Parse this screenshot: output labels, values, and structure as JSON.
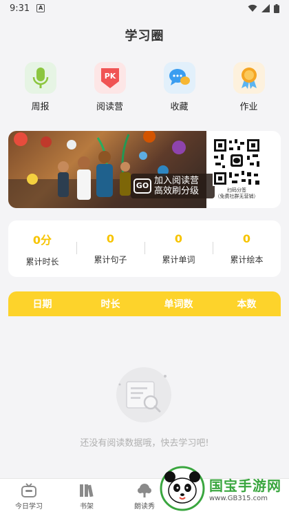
{
  "status": {
    "time": "9:31",
    "notif_letter": "A"
  },
  "title": "学习圈",
  "shortcuts": [
    {
      "label": "周报",
      "icon": "microphone-icon",
      "bg": "#e6f4e4"
    },
    {
      "label": "阅读营",
      "icon": "pk-shield-icon",
      "bg": "#fde6e6",
      "badge": "PK"
    },
    {
      "label": "收藏",
      "icon": "chat-bubble-icon",
      "bg": "#e2f0fb"
    },
    {
      "label": "作业",
      "icon": "medal-icon",
      "bg": "#fdf1dd"
    }
  ],
  "banner": {
    "go": "GO",
    "line1": "加入阅读营",
    "line2": "高效刷分级",
    "qr_line1": "扫码分签",
    "qr_line2": "（免费社群无营销）"
  },
  "stats": [
    {
      "value": "0分",
      "label": "累计时长"
    },
    {
      "value": "0",
      "label": "累计句子"
    },
    {
      "value": "0",
      "label": "累计单词"
    },
    {
      "value": "0",
      "label": "累计绘本"
    }
  ],
  "table_columns": [
    "日期",
    "时长",
    "单词数",
    "本数"
  ],
  "empty_message": "还没有阅读数据哦，快去学习吧!",
  "tabs": [
    {
      "label": "今日学习",
      "icon": "tv-icon"
    },
    {
      "label": "书架",
      "icon": "books-icon"
    },
    {
      "label": "朗读秀",
      "icon": "tree-icon"
    }
  ],
  "watermark": {
    "title": "国宝手游网",
    "url": "www.GB315.com"
  },
  "colors": {
    "accent": "#fdd32b",
    "stat_value": "#f7c400"
  }
}
